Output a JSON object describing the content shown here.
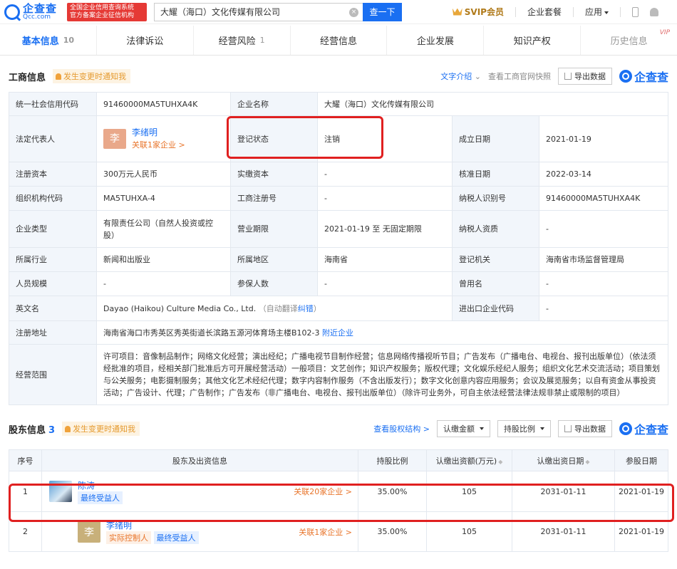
{
  "header": {
    "logo_cn": "企查查",
    "logo_en": "Qcc.com",
    "slogan_line1": "全国企业信用查询系统",
    "slogan_line2": "官方备案企业征信机构",
    "search_value": "大耀（海口）文化传媒有限公司",
    "search_button": "查一下",
    "svip": "SVIP会员",
    "package": "企业套餐",
    "apps": "应用"
  },
  "tabs": [
    {
      "label": "基本信息",
      "count": "10"
    },
    {
      "label": "法律诉讼",
      "count": ""
    },
    {
      "label": "经营风险",
      "count": "1"
    },
    {
      "label": "经营信息",
      "count": ""
    },
    {
      "label": "企业发展",
      "count": ""
    },
    {
      "label": "知识产权",
      "count": ""
    },
    {
      "label": "历史信息",
      "count": "",
      "vip": "VIP"
    }
  ],
  "business": {
    "title": "工商信息",
    "notice": "发生变更时通知我",
    "text_intro": "文字介绍",
    "official_site": "查看工商官网快照",
    "export": "导出数据",
    "watermark": "企查查",
    "rows": {
      "credit_code_k": "统一社会信用代码",
      "credit_code_v": "91460000MA5TUHXA4K",
      "name_k": "企业名称",
      "name_v": "大耀（海口）文化传媒有限公司",
      "legal_k": "法定代表人",
      "legal_avatar": "李",
      "legal_name": "李绪明",
      "legal_rel": "关联1家企业 >",
      "status_k": "登记状态",
      "status_v": "注销",
      "founded_k": "成立日期",
      "founded_v": "2021-01-19",
      "capital_k": "注册资本",
      "capital_v": "300万元人民币",
      "paid_k": "实缴资本",
      "paid_v": "-",
      "approved_k": "核准日期",
      "approved_v": "2022-03-14",
      "org_k": "组织机构代码",
      "org_v": "MA5TUHXA-4",
      "reg_no_k": "工商注册号",
      "reg_no_v": "-",
      "tax_id_k": "纳税人识别号",
      "tax_id_v": "91460000MA5TUHXA4K",
      "type_k": "企业类型",
      "type_v": "有限责任公司（自然人投资或控股）",
      "term_k": "营业期限",
      "term_v": "2021-01-19 至 无固定期限",
      "tax_q_k": "纳税人资质",
      "tax_q_v": "-",
      "industry_k": "所属行业",
      "industry_v": "新闻和出版业",
      "region_k": "所属地区",
      "region_v": "海南省",
      "authority_k": "登记机关",
      "authority_v": "海南省市场监督管理局",
      "staff_k": "人员规模",
      "staff_v": "-",
      "insured_k": "参保人数",
      "insured_v": "-",
      "former_k": "曾用名",
      "former_v": "-",
      "en_k": "英文名",
      "en_v": "Dayao (Haikou) Culture Media Co., Ltd.",
      "en_auto": "（自动翻译",
      "en_fix": "纠错",
      "en_close": "）",
      "ie_k": "进出口企业代码",
      "ie_v": "-",
      "addr_k": "注册地址",
      "addr_v": "海南省海口市秀英区秀英街道长滨路五源河体育场主楼B102-3",
      "addr_link": "附近企业",
      "scope_k": "经营范围",
      "scope_v": "许可项目：音像制品制作；网络文化经营；演出经纪；广播电视节目制作经营；信息网络传播视听节目；广告发布（广播电台、电视台、报刊出版单位）（依法须经批准的项目，经相关部门批准后方可开展经营活动）一般项目：文艺创作；知识产权服务；版权代理；文化娱乐经纪人服务；组织文化艺术交流活动；项目策划与公关服务；电影摄制服务；其他文化艺术经纪代理；数字内容制作服务（不含出版发行）；数字文化创意内容应用服务；会议及展览服务；以自有资金从事投资活动；广告设计、代理；广告制作；广告发布（非广播电台、电视台、报刊出版单位）（除许可业务外，可自主依法经营法律法规非禁止或限制的项目）"
    }
  },
  "shareholders": {
    "title": "股东信息",
    "count": "3",
    "notice": "发生变更时通知我",
    "structure": "查看股权结构 >",
    "filter1": "认缴金额",
    "filter2": "持股比例",
    "export": "导出数据",
    "watermark": "企查查",
    "headers": [
      "序号",
      "股东及出资信息",
      "持股比例",
      "认缴出资额(万元)",
      "认缴出资日期",
      "参股日期"
    ],
    "rows": [
      {
        "no": "1",
        "name": "陈涛",
        "tags": [
          "最终受益人"
        ],
        "rel": "关联20家企业 >",
        "ratio": "35.00%",
        "amount": "105",
        "date": "2031-01-11",
        "join": "2021-01-19"
      },
      {
        "no": "2",
        "avatar": "李",
        "name": "李绪明",
        "tags": [
          "实际控制人",
          "最终受益人"
        ],
        "rel": "关联1家企业 >",
        "ratio": "35.00%",
        "amount": "105",
        "date": "2031-01-11",
        "join": "2021-01-19"
      }
    ]
  }
}
